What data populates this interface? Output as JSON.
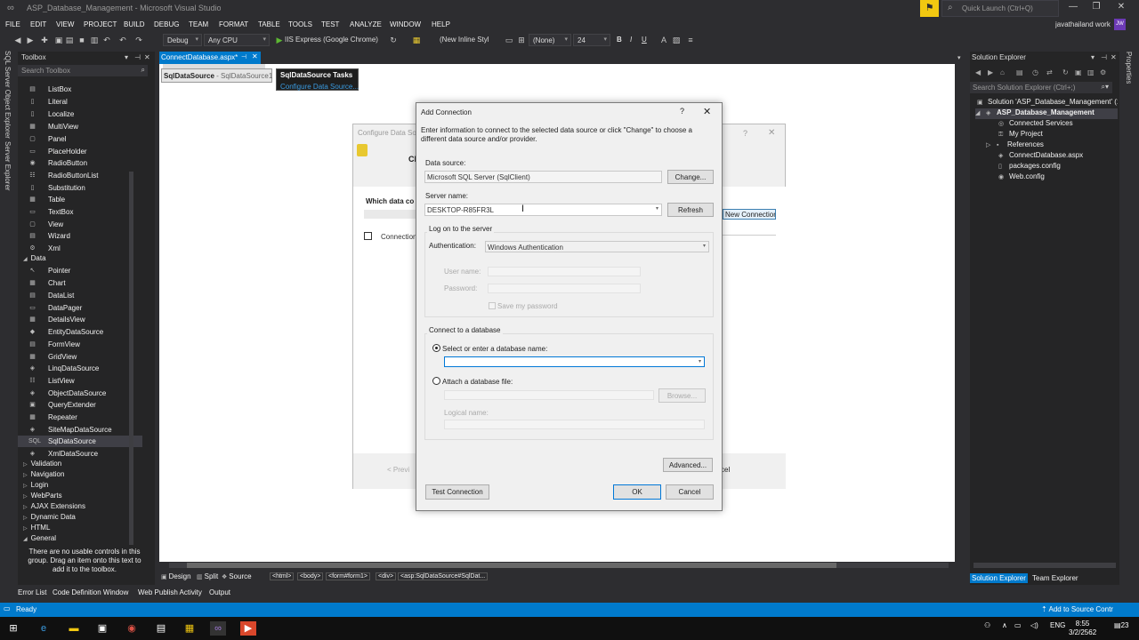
{
  "window": {
    "title": "ASP_Database_Management - Microsoft Visual Studio",
    "quick_launch_placeholder": "Quick Launch (Ctrl+Q)",
    "user": "javathailand work",
    "avatar_initials": "JW"
  },
  "menu": [
    "FILE",
    "EDIT",
    "VIEW",
    "PROJECT",
    "BUILD",
    "DEBUG",
    "TEAM",
    "FORMAT",
    "TABLE",
    "TOOLS",
    "TEST",
    "ANALYZE",
    "WINDOW",
    "HELP"
  ],
  "toolbar": {
    "config": "Debug",
    "platform": "Any CPU",
    "run_target": "IIS Express (Google Chrome)",
    "style": "(New Inline Styl",
    "block_format": "(None)",
    "font_size": "24",
    "bold": "B",
    "italic": "I",
    "underline": "U"
  },
  "left_vertical_tabs": [
    "SQL Server Object Explorer",
    "Server Explorer"
  ],
  "toolbox": {
    "title": "Toolbox",
    "search_placeholder": "Search Toolbox",
    "standard_items": [
      "ListBox",
      "Literal",
      "Localize",
      "MultiView",
      "Panel",
      "PlaceHolder",
      "RadioButton",
      "RadioButtonList",
      "Substitution",
      "Table",
      "TextBox",
      "View",
      "Wizard",
      "Xml"
    ],
    "data_group": "Data",
    "data_items": [
      "Pointer",
      "Chart",
      "DataList",
      "DataPager",
      "DetailsView",
      "EntityDataSource",
      "FormView",
      "GridView",
      "LinqDataSource",
      "ListView",
      "ObjectDataSource",
      "QueryExtender",
      "Repeater",
      "SiteMapDataSource",
      "SqlDataSource",
      "XmlDataSource"
    ],
    "selected_item": "SqlDataSource",
    "collapsed_groups": [
      "Validation",
      "Navigation",
      "Login",
      "WebParts",
      "AJAX Extensions",
      "Dynamic Data",
      "HTML"
    ],
    "general_group": "General",
    "empty_message": "There are no usable controls in this group. Drag an item onto this text to add it to the toolbox."
  },
  "document": {
    "tab_label": "ConnectDatabase.aspx*",
    "sds_control": "SqlDataSource",
    "sds_id": "- SqlDataSource1",
    "tasks_title": "SqlDataSource Tasks",
    "tasks_link": "Configure Data Source..."
  },
  "configure_dialog": {
    "title": "Configure Data So",
    "heading_fragment": "Ch",
    "which_label": "Which data co",
    "checkbox_label": "Connection",
    "new_connection": "New Connection...",
    "prev": "< Previ",
    "cancel_fragment": "cel"
  },
  "add_connection": {
    "title": "Add Connection",
    "help": "?",
    "close": "✕",
    "intro": "Enter information to connect to the selected data source or click \"Change\" to choose a different data source and/or provider.",
    "data_source_label": "Data source:",
    "data_source_value": "Microsoft SQL Server (SqlClient)",
    "change_button": "Change...",
    "server_name_label": "Server name:",
    "server_name_value": "DESKTOP-R85FR3L",
    "refresh_button": "Refresh",
    "logon_group": "Log on to the server",
    "auth_label": "Authentication:",
    "auth_value": "Windows Authentication",
    "user_name_label": "User name:",
    "password_label": "Password:",
    "save_password": "Save my password",
    "connect_group": "Connect to a database",
    "select_db_option": "Select or enter a database name:",
    "attach_option": "Attach a database file:",
    "browse_button": "Browse...",
    "logical_name_label": "Logical name:",
    "advanced_button": "Advanced...",
    "test_button": "Test Connection",
    "ok_button": "OK",
    "cancel_button": "Cancel"
  },
  "solution_explorer": {
    "title": "Solution Explorer",
    "search_placeholder": "Search Solution Explorer (Ctrl+;)",
    "solution": "Solution 'ASP_Database_Management' (1",
    "project": "ASP_Database_Management",
    "items": [
      "Connected Services",
      "My Project",
      "References",
      "ConnectDatabase.aspx",
      "packages.config",
      "Web.config"
    ],
    "tab_solution": "Solution Explorer",
    "tab_team": "Team Explorer",
    "right_tab": "Properties"
  },
  "view_bar": {
    "design": "Design",
    "split": "Split",
    "source": "Source",
    "crumbs": [
      "<html>",
      "<body>",
      "<form#form1>",
      "<div>",
      "<asp:SqlDataSource#SqlDat..."
    ]
  },
  "output_tabs": [
    "Error List",
    "Code Definition Window",
    "Web Publish Activity",
    "Output"
  ],
  "status": {
    "text": "Ready",
    "source_control": "Add to Source Contr"
  },
  "taskbar": {
    "lang": "ENG",
    "time": "8:55",
    "date": "3/2/2562",
    "notif_count": "23"
  },
  "colors": {
    "accent": "#007acc",
    "ide_background": "#2d2d30",
    "dialog_background": "#f0f0f0"
  }
}
